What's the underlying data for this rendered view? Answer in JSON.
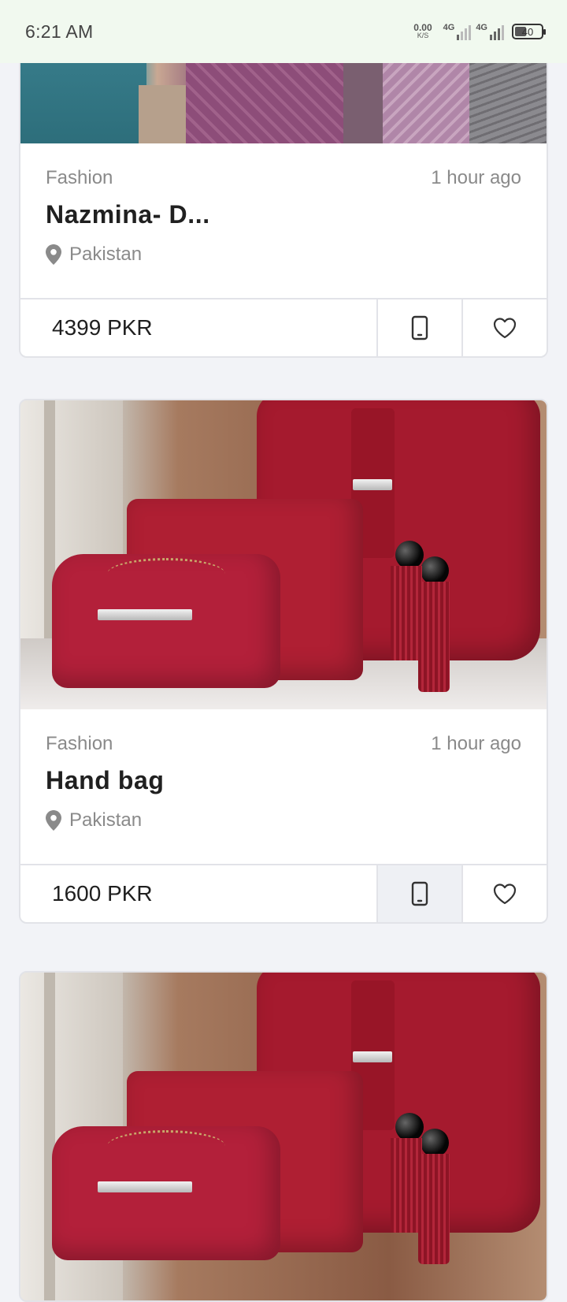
{
  "status_bar": {
    "time": "6:21 AM",
    "net_speed_value": "0.00",
    "net_speed_unit": "K/S",
    "signal1_label": "4G",
    "signal2_label": "4G",
    "battery": "40"
  },
  "listings": [
    {
      "category": "Fashion",
      "posted": "1 hour ago",
      "title": "Nazmina- D...",
      "location": "Pakistan",
      "price": "4399 PKR"
    },
    {
      "category": "Fashion",
      "posted": "1 hour ago",
      "title": "Hand bag",
      "location": "Pakistan",
      "price": "1600 PKR"
    }
  ],
  "icons": {
    "location": "map-pin-icon",
    "call": "phone-icon",
    "favorite": "heart-outline-icon"
  },
  "colors": {
    "status_bar_bg": "#f1f9ef",
    "page_bg": "#f2f3f7",
    "card_border": "#e2e3e8",
    "muted_text": "#8a8a8a"
  }
}
